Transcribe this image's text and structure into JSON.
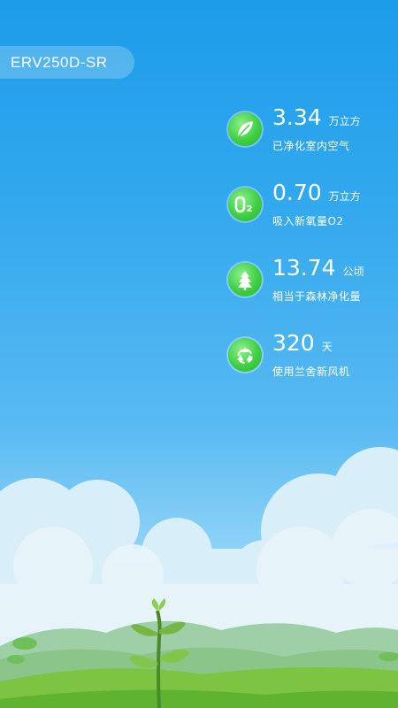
{
  "device": {
    "name": "ERV250D-SR"
  },
  "stats": [
    {
      "icon": "leaf-icon",
      "value": "3.34",
      "unit": "万立方",
      "label": "已净化室内空气"
    },
    {
      "icon": "o2-icon",
      "value": "0.70",
      "unit": "万立方",
      "label": "吸入新氧量O2"
    },
    {
      "icon": "tree-icon",
      "value": "13.74",
      "unit": "公顷",
      "label": "相当于森林净化量"
    },
    {
      "icon": "recycle-icon",
      "value": "320",
      "unit": "天",
      "label": "使用兰舍新风机"
    }
  ],
  "o2_icon_text": "O2",
  "colors": {
    "sky_top": "#1d9ce9",
    "icon_green": "#3fcf43",
    "grass": "#7cc441"
  }
}
